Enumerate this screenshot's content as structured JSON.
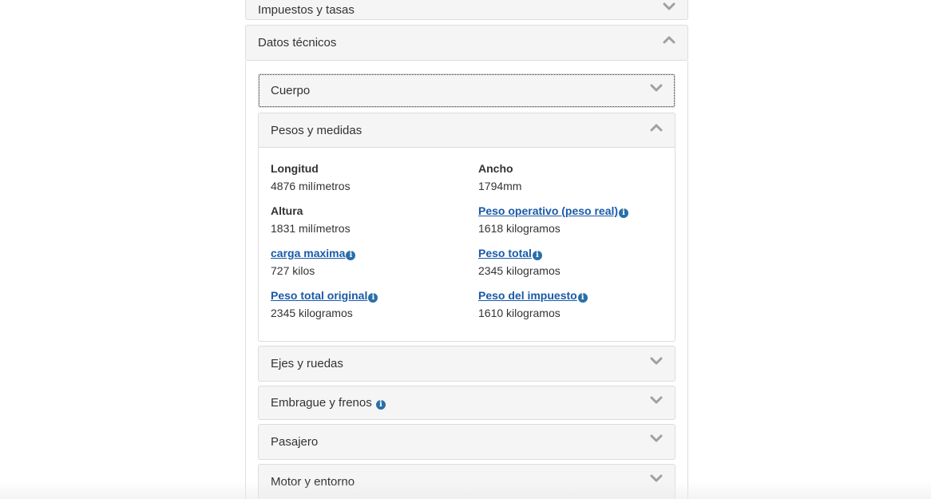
{
  "sections": {
    "taxes": {
      "title": "Impuestos y tasas",
      "state": "collapsed"
    },
    "technical": {
      "title": "Datos técnicos",
      "state": "expanded"
    }
  },
  "technical": {
    "panels": [
      {
        "title": "Cuerpo",
        "state": "collapsed",
        "focused": true
      },
      {
        "title": "Pesos y medidas",
        "state": "expanded"
      },
      {
        "title": "Ejes y ruedas",
        "state": "collapsed"
      },
      {
        "title": "Embrague y frenos",
        "state": "collapsed",
        "has_info_icon": true
      },
      {
        "title": "Pasajero",
        "state": "collapsed"
      },
      {
        "title": "Motor y entorno",
        "state": "collapsed"
      }
    ],
    "weights": {
      "longitud": {
        "label": "Longitud",
        "value": "4876 milímetros"
      },
      "ancho": {
        "label": "Ancho",
        "value": "1794mm"
      },
      "altura": {
        "label": "Altura",
        "value": "1831 milímetros"
      },
      "peso_operativo": {
        "label": "Peso operativo (peso real)",
        "value": "1618 kilogramos"
      },
      "carga_maxima": {
        "label": "carga maxima",
        "value": "727 kilos"
      },
      "peso_total": {
        "label": "Peso total",
        "value": "2345 kilogramos"
      },
      "peso_total_original": {
        "label": "Peso total original",
        "value": "2345 kilogramos"
      },
      "peso_impuesto": {
        "label": "Peso del impuesto",
        "value": "1610 kilogramos"
      }
    }
  },
  "icons": {
    "expand": "chevron-down-icon",
    "collapse": "chevron-up-icon",
    "info": "info-icon"
  },
  "colors": {
    "link": "#1a5aa8",
    "info_icon": "#2a6fa8",
    "panel_header_bg": "#f5f5f5",
    "border": "#dddddd",
    "chevron": "#999999"
  }
}
